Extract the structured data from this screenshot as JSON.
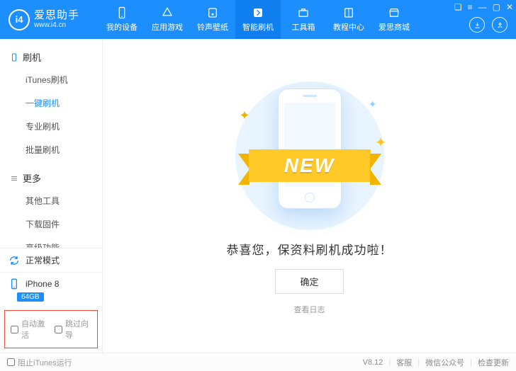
{
  "app": {
    "name": "爱思助手",
    "url": "www.i4.cn",
    "logo_text": "i4",
    "version": "V8.12"
  },
  "header_tabs": [
    {
      "label": "我的设备",
      "icon": "phone"
    },
    {
      "label": "应用游戏",
      "icon": "apps"
    },
    {
      "label": "铃声壁纸",
      "icon": "music"
    },
    {
      "label": "智能刷机",
      "icon": "flash",
      "active": true
    },
    {
      "label": "工具箱",
      "icon": "toolbox"
    },
    {
      "label": "教程中心",
      "icon": "book"
    },
    {
      "label": "爱思商城",
      "icon": "shop"
    }
  ],
  "sidebar": {
    "group1_title": "刷机",
    "group1_items": [
      {
        "label": "iTunes刷机"
      },
      {
        "label": "一键刷机",
        "active": true
      },
      {
        "label": "专业刷机"
      },
      {
        "label": "批量刷机"
      }
    ],
    "group2_title": "更多",
    "group2_items": [
      {
        "label": "其他工具"
      },
      {
        "label": "下载固件"
      },
      {
        "label": "高级功能"
      }
    ],
    "mode_label": "正常模式",
    "device_label": "iPhone 8",
    "capacity_label": "64GB",
    "check_auto_activate": "自动激活",
    "check_skip_setup": "跳过向导"
  },
  "content": {
    "ribbon_text": "NEW",
    "success_text": "恭喜您，保资料刷机成功啦！",
    "ok_button": "确定",
    "view_log": "查看日志"
  },
  "footer": {
    "block_itunes": "阻止iTunes运行",
    "support": "客服",
    "wechat": "微信公众号",
    "check_update": "检查更新"
  }
}
